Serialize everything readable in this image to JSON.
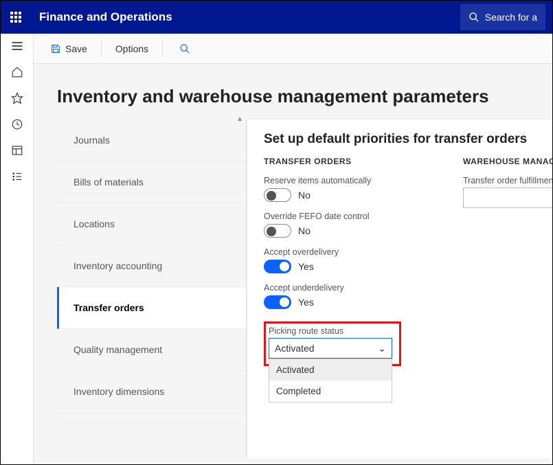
{
  "app_title": "Finance and Operations",
  "search_placeholder": "Search for a",
  "commands": {
    "save": "Save",
    "options": "Options"
  },
  "page_title": "Inventory and warehouse management parameters",
  "nav_items": [
    "Journals",
    "Bills of materials",
    "Locations",
    "Inventory accounting",
    "Transfer orders",
    "Quality management",
    "Inventory dimensions"
  ],
  "nav_active_index": 4,
  "panel": {
    "heading": "Set up default priorities for transfer orders",
    "section1_title": "TRANSFER ORDERS",
    "section2_title": "WAREHOUSE MANAGEME",
    "toggles": [
      {
        "label": "Reserve items automatically",
        "on": false,
        "text": "No"
      },
      {
        "label": "Override FEFO date control",
        "on": false,
        "text": "No"
      },
      {
        "label": "Accept overdelivery",
        "on": true,
        "text": "Yes"
      },
      {
        "label": "Accept underdelivery",
        "on": true,
        "text": "Yes"
      }
    ],
    "dropdown": {
      "label": "Picking route status",
      "value": "Activated",
      "options": [
        "Activated",
        "Completed"
      ]
    },
    "wh_field_label": "Transfer order fulfillment po"
  }
}
